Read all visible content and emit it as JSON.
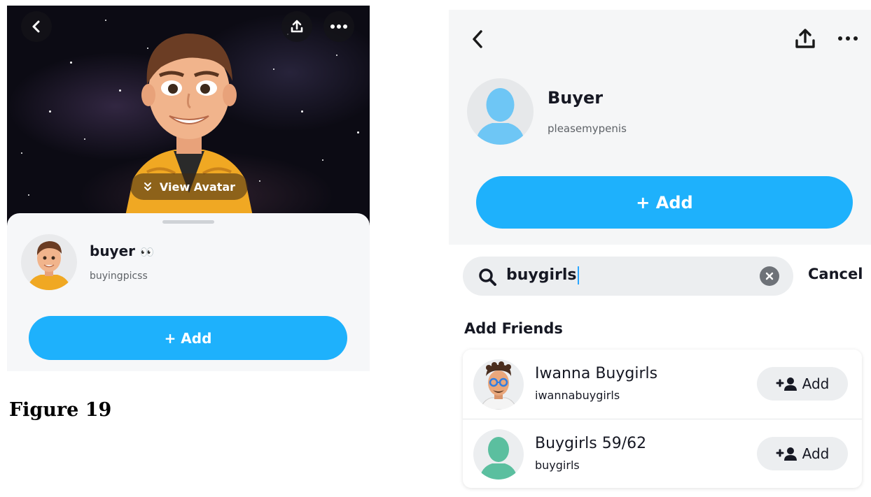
{
  "left_screen": {
    "view_avatar_label": "View Avatar",
    "display_name": "buyer",
    "name_emoji": "👀",
    "username": "buyingpicss",
    "add_label": "+ Add"
  },
  "figure_caption": "Figure 19",
  "right_screen": {
    "display_name": "Buyer",
    "username": "pleasemypenis",
    "add_label": "+ Add",
    "search": {
      "value": "buygirls",
      "cancel_label": "Cancel"
    },
    "section_title": "Add Friends",
    "results": [
      {
        "name": "Iwanna Buygirls",
        "username": "iwannabuygirls",
        "add_label": "Add"
      },
      {
        "name": "Buygirls 59/62",
        "username": "buygirls",
        "add_label": "Add"
      }
    ]
  },
  "colors": {
    "accent": "#1eb1fc",
    "ghost_avatar_blue": "#6ec6f5",
    "ghost_avatar_teal": "#5bbf9f"
  },
  "icons": [
    "back-chevron-icon",
    "share-icon",
    "more-icon",
    "double-chevron-down-icon",
    "search-icon",
    "clear-icon",
    "add-friend-icon"
  ]
}
